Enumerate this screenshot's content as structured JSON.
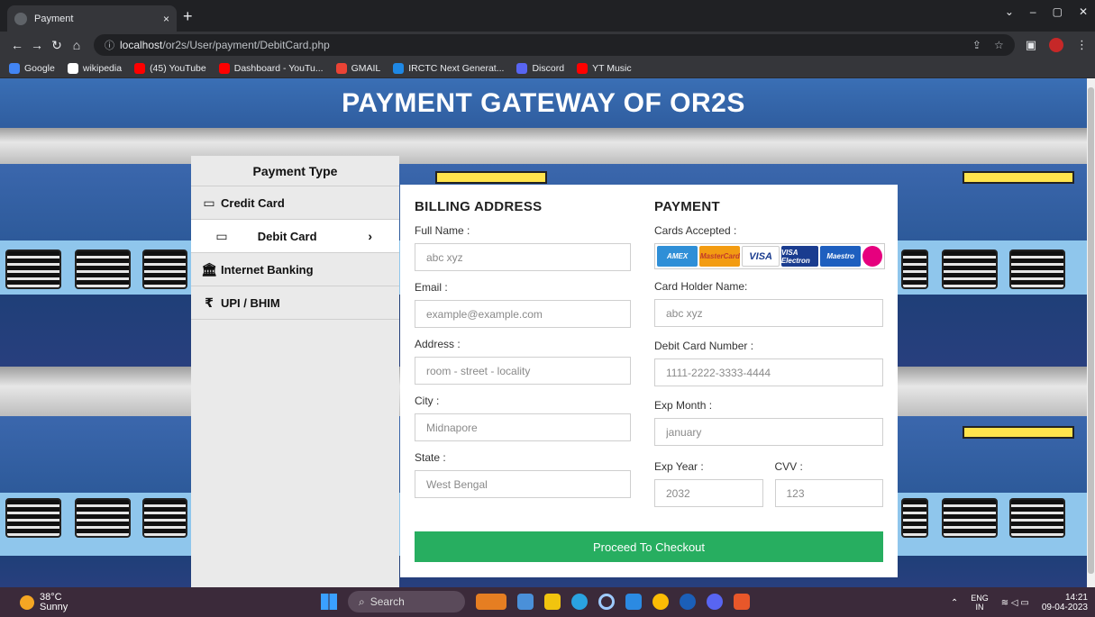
{
  "browser": {
    "tab_title": "Payment",
    "tab_close": "×",
    "new_tab": "+",
    "url_host": "localhost",
    "url_path": "/or2s/User/payment/DebitCard.php",
    "bookmarks": [
      {
        "label": "Google",
        "color": "#4285f4"
      },
      {
        "label": "wikipedia",
        "color": "#ffffff"
      },
      {
        "label": "(45) YouTube",
        "color": "#ff0000"
      },
      {
        "label": "Dashboard - YouTu...",
        "color": "#ff0000"
      },
      {
        "label": "GMAIL",
        "color": "#ea4335"
      },
      {
        "label": "IRCTC Next Generat...",
        "color": "#1e88e5"
      },
      {
        "label": "Discord",
        "color": "#5865f2"
      },
      {
        "label": "YT Music",
        "color": "#ff0000"
      }
    ]
  },
  "page": {
    "title": "PAYMENT GATEWAY OF OR2S"
  },
  "sidebar": {
    "heading": "Payment Type",
    "items": [
      {
        "label": "Credit Card",
        "icon": "credit-card-icon",
        "glyph": "▭"
      },
      {
        "label": "Debit Card",
        "icon": "debit-card-icon",
        "glyph": "▭",
        "active": true,
        "chevron": "›"
      },
      {
        "label": "Internet Banking",
        "icon": "bank-icon",
        "glyph": "🏛"
      },
      {
        "label": "UPI / BHIM",
        "icon": "rupee-icon",
        "glyph": "₹"
      }
    ]
  },
  "billing": {
    "heading": "BILLING ADDRESS",
    "full_name_label": "Full Name :",
    "full_name_placeholder": "abc xyz",
    "email_label": "Email :",
    "email_placeholder": "example@example.com",
    "address_label": "Address :",
    "address_placeholder": "room - street - locality",
    "city_label": "City :",
    "city_placeholder": "Midnapore",
    "state_label": "State :",
    "state_placeholder": "West Bengal"
  },
  "payment": {
    "heading": "PAYMENT",
    "cards_label": "Cards Accepted :",
    "cards": [
      "AMEX",
      "MasterCard",
      "VISA",
      "VISA Electron",
      "Maestro",
      ""
    ],
    "holder_label": "Card Holder Name:",
    "holder_placeholder": "abc xyz",
    "number_label": "Debit Card Number :",
    "number_placeholder": "1111-2222-3333-4444",
    "exp_month_label": "Exp Month :",
    "exp_month_placeholder": "january",
    "exp_year_label": "Exp Year :",
    "exp_year_placeholder": "2032",
    "cvv_label": "CVV :",
    "cvv_placeholder": "123"
  },
  "checkout_label": "Proceed To Checkout",
  "taskbar": {
    "temp": "38°C",
    "condition": "Sunny",
    "search": "Search",
    "lang_top": "ENG",
    "lang_bottom": "IN",
    "time": "14:21",
    "date": "09-04-2023"
  }
}
